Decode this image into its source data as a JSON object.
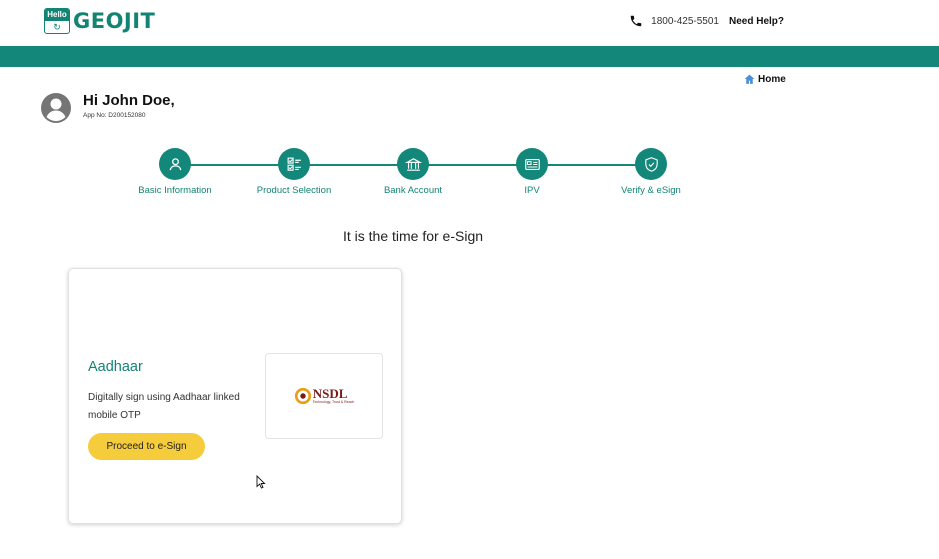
{
  "header": {
    "logo_badge": "Hello",
    "logo_text": "GEOJIT",
    "phone": "1800-425-5501",
    "need_help": "Need Help?"
  },
  "nav": {
    "home": "Home"
  },
  "greeting": {
    "name": "Hi John Doe,",
    "app_no": "App No: D200152080"
  },
  "steps": [
    {
      "label": "Basic Information",
      "icon": "user-icon"
    },
    {
      "label": "Product Selection",
      "icon": "checklist-icon"
    },
    {
      "label": "Bank Account",
      "icon": "bank-icon"
    },
    {
      "label": "IPV",
      "icon": "id-card-icon"
    },
    {
      "label": "Verify & eSign",
      "icon": "shield-check-icon"
    }
  ],
  "main": {
    "title": "It is the time for e-Sign"
  },
  "card": {
    "title": "Aadhaar",
    "description": "Digitally sign using Aadhaar linked mobile OTP",
    "button": "Proceed to e-Sign",
    "provider_name": "NSDL",
    "provider_tagline": "Technology, Trust & Reach"
  },
  "colors": {
    "brand": "#13877a",
    "button": "#f5cc3c"
  }
}
